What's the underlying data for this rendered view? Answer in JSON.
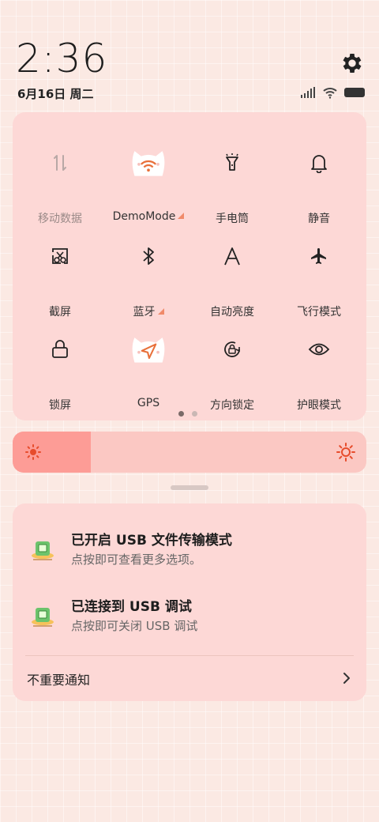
{
  "status": {
    "time": "2:36",
    "date": "6月16日 周二"
  },
  "quick_settings": {
    "tiles": [
      {
        "label": "移动数据",
        "icon": "mobile-data-icon",
        "active": false
      },
      {
        "label": "DemoMode",
        "icon": "wifi-cat-icon",
        "active": true,
        "expandable": true
      },
      {
        "label": "手电筒",
        "icon": "flashlight-icon",
        "active": false
      },
      {
        "label": "静音",
        "icon": "bell-icon",
        "active": false
      },
      {
        "label": "截屏",
        "icon": "screenshot-icon",
        "active": false
      },
      {
        "label": "蓝牙",
        "icon": "bluetooth-icon",
        "active": false,
        "expandable": true
      },
      {
        "label": "自动亮度",
        "icon": "auto-brightness-icon",
        "active": false
      },
      {
        "label": "飞行模式",
        "icon": "airplane-icon",
        "active": false
      },
      {
        "label": "锁屏",
        "icon": "lock-icon",
        "active": false
      },
      {
        "label": "GPS",
        "icon": "location-cat-icon",
        "active": true
      },
      {
        "label": "方向锁定",
        "icon": "rotation-lock-icon",
        "active": false
      },
      {
        "label": "护眼模式",
        "icon": "eye-icon",
        "active": false
      }
    ],
    "page_count": 2,
    "current_page": 1
  },
  "brightness": {
    "level": 0.22
  },
  "notifications": [
    {
      "title": "已开启 USB 文件传输模式",
      "subtitle": "点按即可查看更多选项。",
      "icon": "usb-icon"
    },
    {
      "title": "已连接到 USB 调试",
      "subtitle": "点按即可关闭 USB 调试",
      "icon": "usb-icon"
    }
  ],
  "unimportant_label": "不重要通知",
  "colors": {
    "background": "#fbe9e3",
    "panel": "#fdd8d6",
    "accent": "#f08a6a",
    "brightness_fill": "#fd9c96"
  }
}
